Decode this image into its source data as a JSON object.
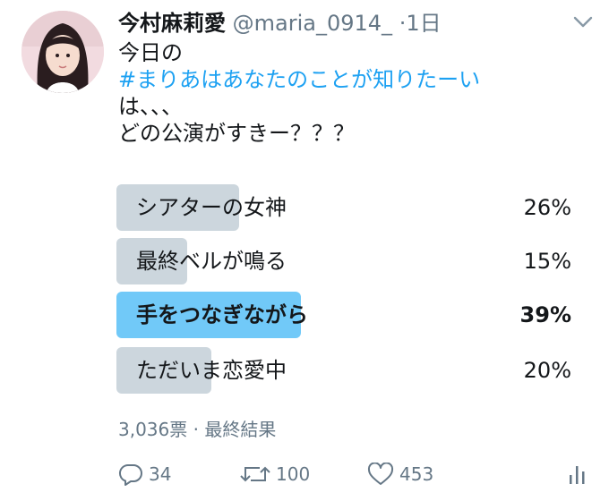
{
  "tweet": {
    "display_name": "今村麻莉愛",
    "handle": "@maria_0914_",
    "time": "·1日",
    "lines": [
      "今日の",
      "#まりあはあなたのことが知りたーい",
      "は、、、",
      "どの公演がすきー？？？"
    ]
  },
  "poll": {
    "options": [
      {
        "label": "シアターの女神",
        "percent_text": "26%",
        "percent": 26,
        "winner": false
      },
      {
        "label": "最終ベルが鳴る",
        "percent_text": "15%",
        "percent": 15,
        "winner": false
      },
      {
        "label": "手をつなぎながら",
        "percent_text": "39%",
        "percent": 39,
        "winner": true
      },
      {
        "label": "ただいま恋愛中",
        "percent_text": "20%",
        "percent": 20,
        "winner": false
      }
    ],
    "votes_status": "3,036票 · 最終結果"
  },
  "actions": {
    "reply_count": "34",
    "retweet_count": "100",
    "like_count": "453"
  },
  "colors": {
    "hashtag": "#1da1f2",
    "poll_bar": "#ccd6dd",
    "poll_bar_winner": "#71c9f8",
    "secondary_text": "#657786"
  },
  "icons": [
    "chevron-down-icon",
    "reply-icon",
    "retweet-icon",
    "like-icon",
    "analytics-icon"
  ]
}
